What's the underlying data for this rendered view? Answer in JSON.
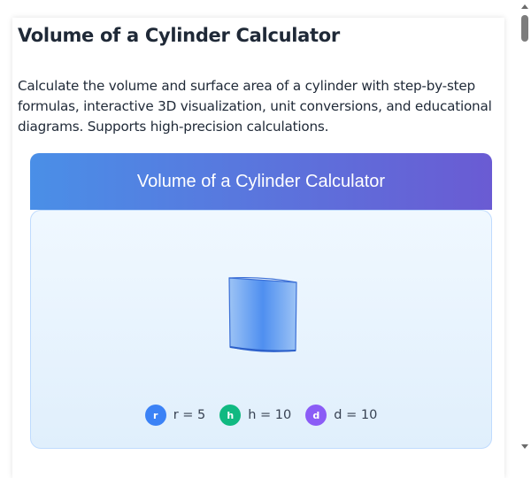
{
  "page": {
    "title": "Volume of a Cylinder Calculator",
    "description": "Calculate the volume and surface area of a cylinder with step-by-step formulas, interactive 3D visualization, unit conversions, and educational diagrams. Supports high-precision calculations."
  },
  "calculator": {
    "header_title": "Volume of a Cylinder Calculator",
    "visualization": {
      "cylinder_icon": "cylinder-3d-icon",
      "dimensions": [
        {
          "badge": "r",
          "label": "r = 5",
          "color": "#3b82f6"
        },
        {
          "badge": "h",
          "label": "h = 10",
          "color": "#10b981"
        },
        {
          "badge": "d",
          "label": "d = 10",
          "color": "#8b5cf6"
        }
      ]
    }
  },
  "colors": {
    "header_gradient_start": "#4a8fe7",
    "header_gradient_end": "#6a5bd3",
    "panel_background": "#e8f3fd"
  }
}
